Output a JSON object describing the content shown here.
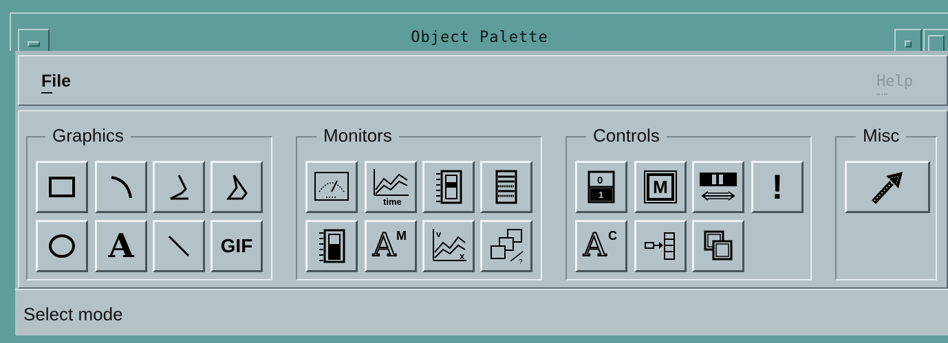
{
  "window": {
    "title": "Object Palette"
  },
  "menubar": {
    "file_label": "File",
    "help_label": "Help"
  },
  "groups": {
    "graphics": {
      "label": "Graphics",
      "tools": [
        "rectangle",
        "arc",
        "polyline",
        "polygon",
        "oval",
        "text",
        "line",
        "gif"
      ],
      "gif_label": "GIF",
      "text_glyph": "A"
    },
    "monitors": {
      "label": "Monitors",
      "tools": [
        "meter",
        "time-plot",
        "indicator",
        "bar-chart",
        "bar-gauge",
        "text-monitor",
        "xy-plot",
        "multi-state"
      ],
      "time_label": "time",
      "am_label": "A",
      "am_sup": "M",
      "xy_v": "v",
      "xy_x": "x"
    },
    "controls": {
      "label": "Controls",
      "tools": [
        "toggle-button",
        "menu-button",
        "slider",
        "alarm",
        "text-control",
        "input-list",
        "option-menu"
      ],
      "menu_m": "M",
      "ac_label": "A",
      "ac_sup": "C",
      "tog_top": "0",
      "tog_bot": "1",
      "alarm_glyph": "!"
    },
    "misc": {
      "label": "Misc",
      "tools": [
        "select-arrow"
      ]
    }
  },
  "status": {
    "text": "Select mode"
  },
  "colors": {
    "title_teal": "#5f9c9c",
    "panel_gray": "#b4c2c8",
    "help_disabled": "#8a979c"
  }
}
